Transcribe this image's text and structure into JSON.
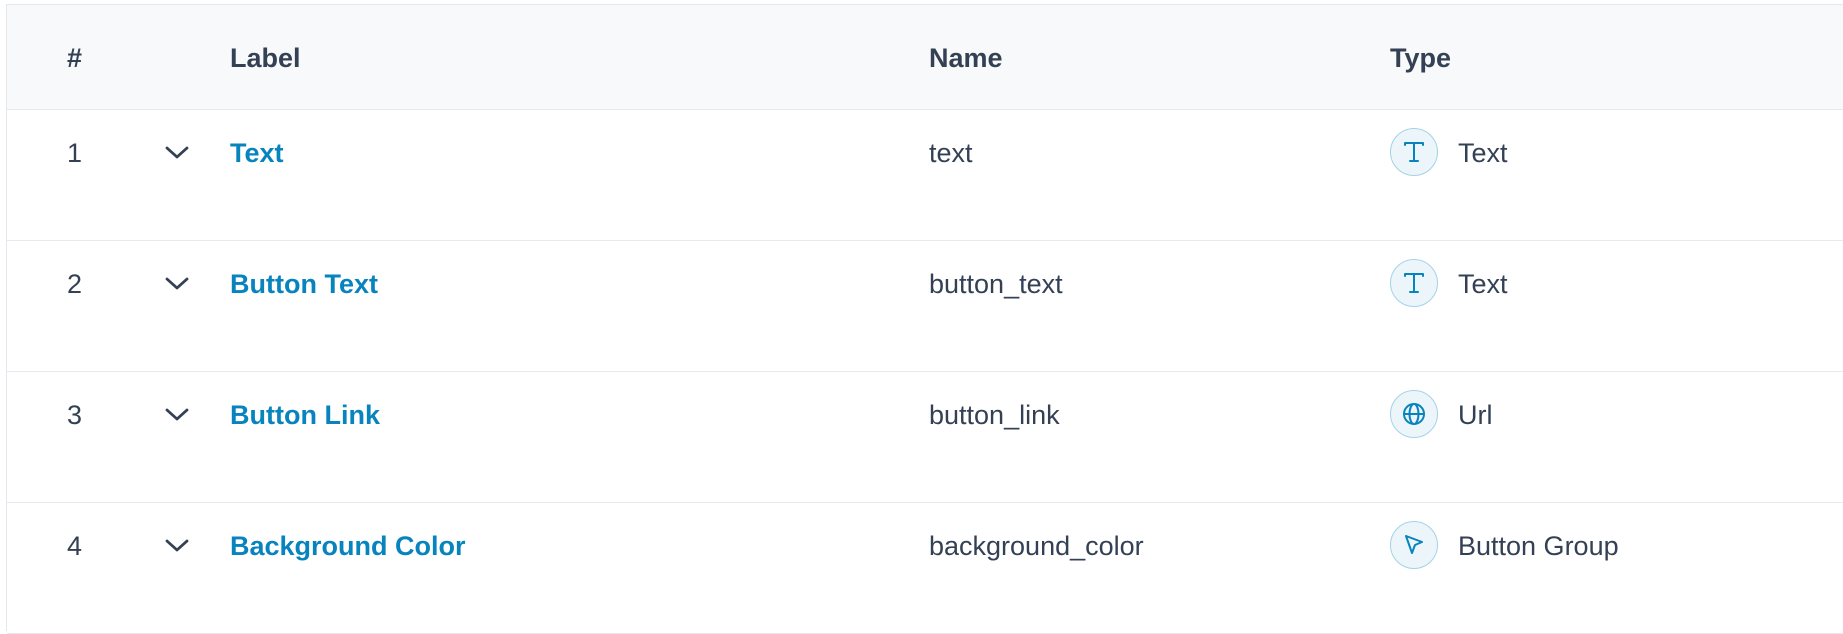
{
  "table": {
    "headers": {
      "order": "#",
      "label": "Label",
      "name": "Name",
      "type": "Type"
    },
    "rows": [
      {
        "order": "1",
        "label": "Text",
        "name": "text",
        "type": "Text",
        "type_icon": "text-type-icon"
      },
      {
        "order": "2",
        "label": "Button Text",
        "name": "button_text",
        "type": "Text",
        "type_icon": "text-type-icon"
      },
      {
        "order": "3",
        "label": "Button Link",
        "name": "button_link",
        "type": "Url",
        "type_icon": "globe-icon"
      },
      {
        "order": "4",
        "label": "Background Color",
        "name": "background_color",
        "type": "Button Group",
        "type_icon": "cursor-pointer-icon"
      }
    ]
  },
  "colors": {
    "accent": "#0783be",
    "header_bg": "#f8f9fa",
    "border": "#e7e9ec",
    "icon_bg": "#ebf5fa"
  }
}
